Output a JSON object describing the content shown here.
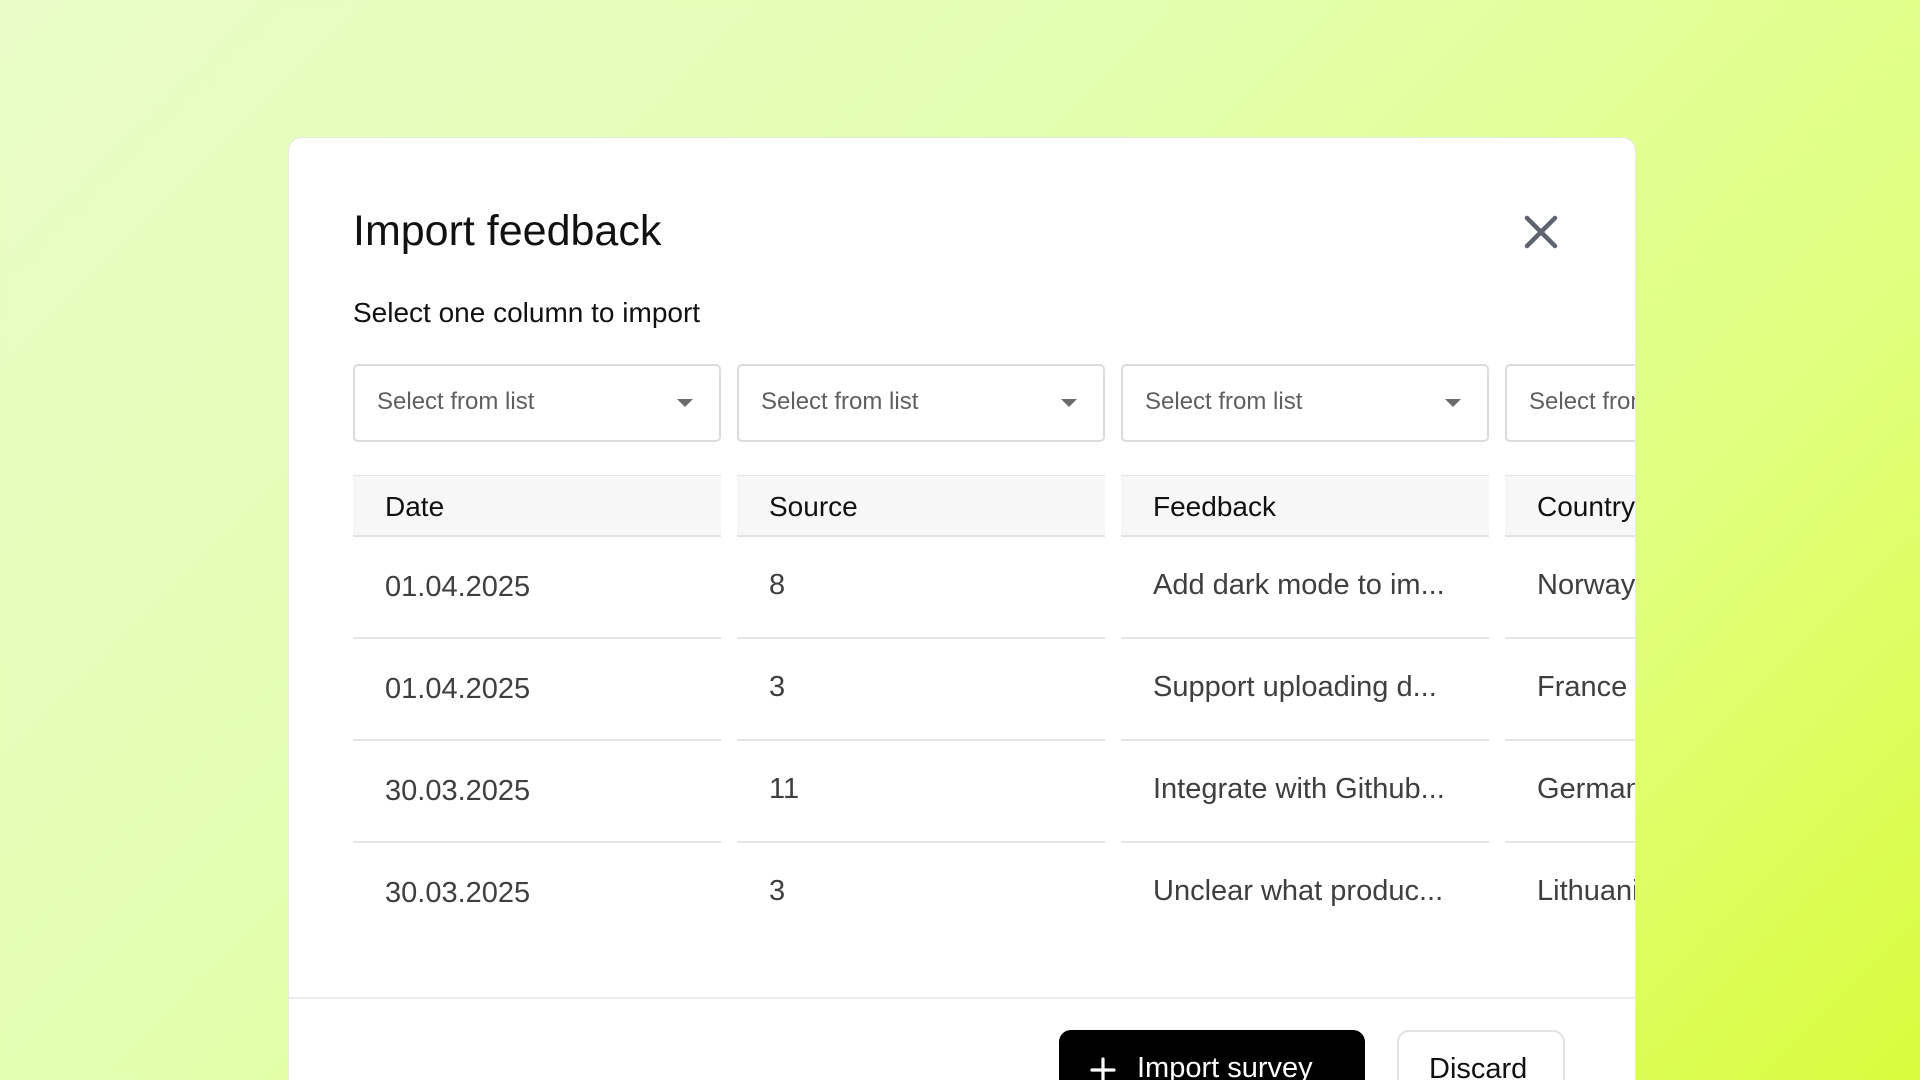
{
  "modal": {
    "title": "Import feedback",
    "subtitle": "Select one column to import",
    "close_icon": "close-icon"
  },
  "columns": [
    {
      "select_placeholder": "Select from list",
      "header": "Date",
      "cells": [
        "01.04.2025",
        "01.04.2025",
        "30.03.2025",
        "30.03.2025"
      ]
    },
    {
      "select_placeholder": "Select from list",
      "header": "Source",
      "cells": [
        "8",
        "3",
        "11",
        "3"
      ]
    },
    {
      "select_placeholder": "Select from list",
      "header": "Feedback",
      "cells": [
        "Add dark mode to im...",
        "Support uploading d...",
        "Integrate with Github...",
        "Unclear what produc..."
      ]
    },
    {
      "select_placeholder": "Select from list",
      "header": "Country",
      "cells": [
        "Norway",
        "France",
        "Germany",
        "Lithuania"
      ]
    }
  ],
  "footer": {
    "import_label": "Import survey",
    "import_icon": "plus-icon",
    "discard_label": "Discard"
  },
  "colors": {
    "primary_button": "#000000",
    "background_gradient_start": "#e9fcc8",
    "background_gradient_end": "#d9fb3c"
  }
}
